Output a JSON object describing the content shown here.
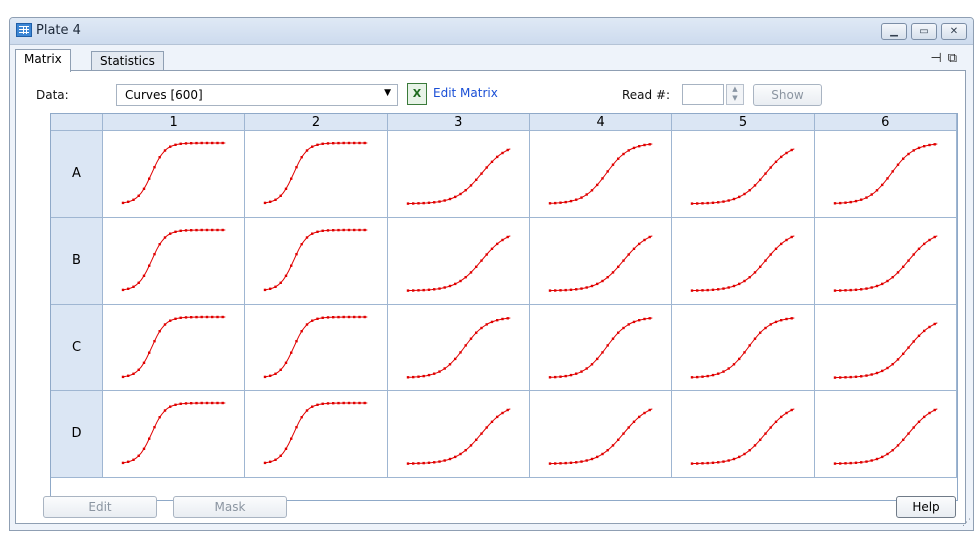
{
  "window": {
    "title": "Plate 4"
  },
  "tabs": [
    {
      "label": "Matrix",
      "active": true
    },
    {
      "label": "Statistics",
      "active": false
    }
  ],
  "toolbar": {
    "data_label": "Data:",
    "data_value": "Curves [600]",
    "edit_matrix_label": "Edit Matrix",
    "read_label": "Read #:",
    "read_value": "",
    "show_label": "Show"
  },
  "grid": {
    "columns": [
      "1",
      "2",
      "3",
      "4",
      "5",
      "6"
    ],
    "rows": [
      "A",
      "B",
      "C",
      "D"
    ],
    "curve_color": "#e00000",
    "curve_shapes": [
      [
        "early-plateau",
        "early-plateau",
        "late-rise",
        "s-rise",
        "late-rise",
        "s-rise"
      ],
      [
        "early-plateau",
        "early-plateau",
        "late-rise",
        "late-rise",
        "late-rise",
        "late-rise"
      ],
      [
        "early-plateau",
        "early-plateau",
        "s-rise",
        "s-rise",
        "s-rise",
        "late-rise"
      ],
      [
        "early-plateau",
        "early-plateau",
        "late-rise",
        "late-rise",
        "late-rise",
        "late-rise"
      ]
    ]
  },
  "footer": {
    "edit_label": "Edit",
    "mask_label": "Mask",
    "help_label": "Help"
  }
}
